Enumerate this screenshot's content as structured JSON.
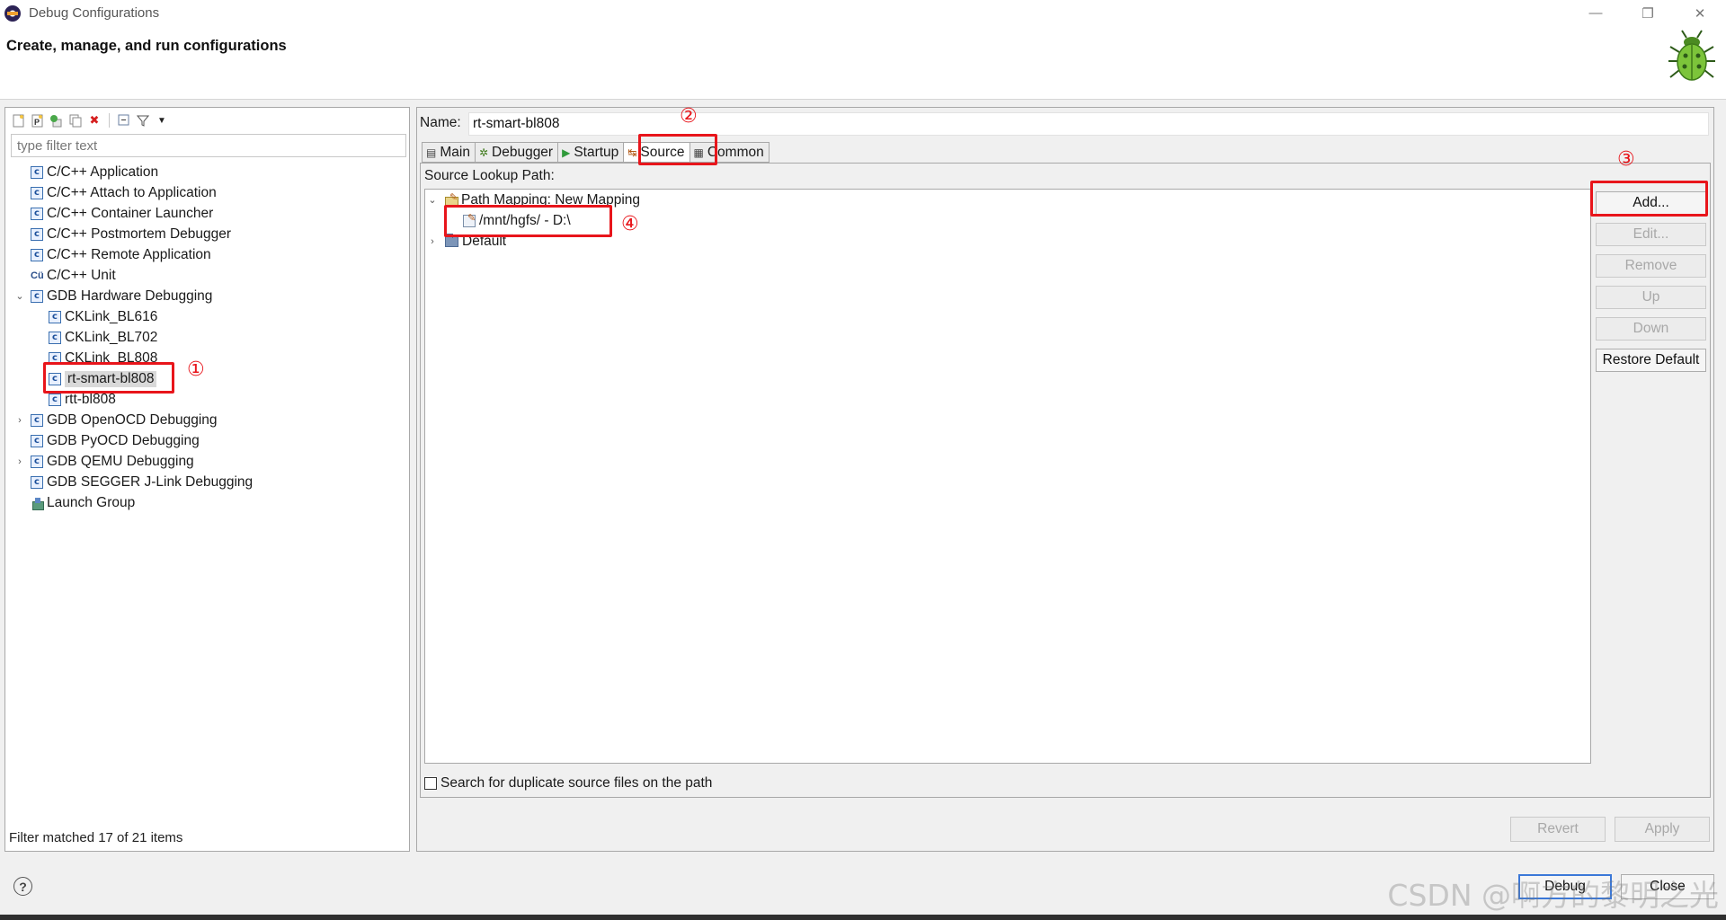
{
  "window": {
    "title": "Debug Configurations",
    "controls": [
      "—",
      "❐",
      "✕"
    ]
  },
  "header": {
    "heading": "Create, manage, and run configurations"
  },
  "left_panel": {
    "filter_placeholder": "type filter text",
    "tree": [
      {
        "label": "C/C++ Application",
        "icon": "c-config-icon",
        "level": 0
      },
      {
        "label": "C/C++ Attach to Application",
        "icon": "c-config-icon",
        "level": 0
      },
      {
        "label": "C/C++ Container Launcher",
        "icon": "c-config-icon",
        "level": 0
      },
      {
        "label": "C/C++ Postmortem Debugger",
        "icon": "c-config-icon",
        "level": 0
      },
      {
        "label": "C/C++ Remote Application",
        "icon": "c-config-icon",
        "level": 0
      },
      {
        "label": "C/C++ Unit",
        "icon": "cunit-icon",
        "level": 0
      },
      {
        "label": "GDB Hardware Debugging",
        "icon": "c-config-icon",
        "level": 0,
        "expanded": true
      },
      {
        "label": "CKLink_BL616",
        "icon": "c-config-icon",
        "level": 1
      },
      {
        "label": "CKLink_BL702",
        "icon": "c-config-icon",
        "level": 1
      },
      {
        "label": "CKLink_BL808",
        "icon": "c-config-icon",
        "level": 1
      },
      {
        "label": "rt-smart-bl808",
        "icon": "c-config-icon",
        "level": 1,
        "selected": true
      },
      {
        "label": "rtt-bl808",
        "icon": "c-config-icon",
        "level": 1
      },
      {
        "label": "GDB OpenOCD Debugging",
        "icon": "c-config-icon",
        "level": 0,
        "collapsed": true
      },
      {
        "label": "GDB PyOCD Debugging",
        "icon": "c-config-icon",
        "level": 0
      },
      {
        "label": "GDB QEMU Debugging",
        "icon": "c-config-icon",
        "level": 0,
        "collapsed": true
      },
      {
        "label": "GDB SEGGER J-Link Debugging",
        "icon": "c-config-icon",
        "level": 0
      },
      {
        "label": "Launch Group",
        "icon": "launch-group-icon",
        "level": 0
      }
    ],
    "status": "Filter matched 17 of 21 items"
  },
  "right_panel": {
    "name_label": "Name:",
    "name_value": "rt-smart-bl808",
    "tabs": [
      {
        "label": "Main",
        "icon": "main-tab-icon"
      },
      {
        "label": "Debugger",
        "icon": "debugger-tab-icon"
      },
      {
        "label": "Startup",
        "icon": "startup-tab-icon"
      },
      {
        "label": "Source",
        "icon": "source-tab-icon",
        "active": true
      },
      {
        "label": "Common",
        "icon": "common-tab-icon"
      }
    ],
    "source_lookup_label": "Source Lookup Path:",
    "lookup_items": [
      {
        "label": "Path Mapping: New Mapping",
        "expanded": true
      },
      {
        "label": "/mnt/hgfs/ - D:\\"
      },
      {
        "label": "Default",
        "collapsed": true
      }
    ],
    "side_buttons": {
      "add": "Add...",
      "edit": "Edit...",
      "remove": "Remove",
      "up": "Up",
      "down": "Down",
      "restore_default": "Restore Default"
    },
    "duplicate_checkbox_label": "Search for duplicate source files on the path",
    "revert": "Revert",
    "apply": "Apply"
  },
  "footer": {
    "help": "?",
    "debug": "Debug",
    "close": "Close"
  },
  "annotations": [
    "①",
    "②",
    "③",
    "④"
  ],
  "watermark": "CSDN @啊方的黎明之光",
  "colors": {
    "annotation_red": "#e8151b",
    "selection_gray": "#d9d9d9",
    "default_button_border": "#3b78d8"
  }
}
